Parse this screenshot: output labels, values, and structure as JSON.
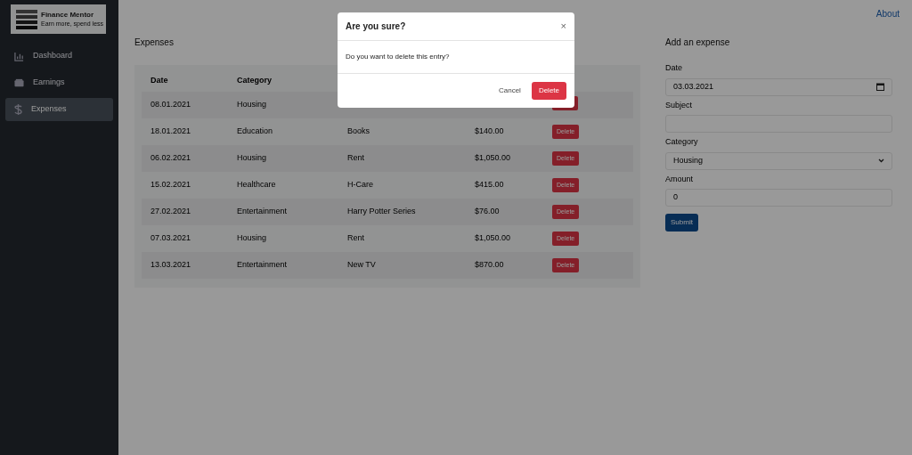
{
  "sidebar": {
    "logo": {
      "title": "Finance Mentor",
      "subtitle": "Earn more, spend less"
    },
    "items": [
      {
        "label": "Dashboard",
        "selected": false
      },
      {
        "label": "Earnings",
        "selected": false
      },
      {
        "label": "Expenses",
        "selected": true
      }
    ]
  },
  "top_link": "About",
  "expenses": {
    "title": "Expenses",
    "columns": [
      "Date",
      "Category"
    ],
    "rows": [
      {
        "date": "08.01.2021",
        "category": "Housing"
      },
      {
        "date": "18.01.2021",
        "category": "Education",
        "subject": "Books",
        "amount": "$140.00",
        "action": "Delete"
      },
      {
        "date": "06.02.2021",
        "category": "Housing",
        "subject": "Rent",
        "amount": "$1,050.00",
        "action": "Delete"
      },
      {
        "date": "15.02.2021",
        "category": "Healthcare",
        "subject": "H-Care",
        "amount": "$415.00",
        "action": "Delete"
      },
      {
        "date": "27.02.2021",
        "category": "Entertainment",
        "subject": "Harry Potter Series",
        "amount": "$76.00",
        "action": "Delete"
      },
      {
        "date": "07.03.2021",
        "category": "Housing",
        "subject": "Rent",
        "amount": "$1,050.00",
        "action": "Delete"
      },
      {
        "date": "13.03.2021",
        "category": "Entertainment",
        "subject": "New TV",
        "amount": "$870.00",
        "action": "Delete"
      }
    ]
  },
  "form": {
    "title": "Add an expense",
    "fields": [
      {
        "kind": "date",
        "label": "Date",
        "value": "03.03.2021"
      },
      {
        "kind": "text",
        "label": "Subject"
      },
      {
        "kind": "select",
        "label": "Category",
        "value": "Housing"
      },
      {
        "kind": "text",
        "label": "Amount",
        "value": "0"
      }
    ],
    "submit": "Submit"
  },
  "modal": {
    "title": "Are you sure?",
    "close": "×",
    "message": "Do you want to delete this entry?",
    "buttons": [
      {
        "kind": "secondary",
        "label": "Cancel"
      },
      {
        "kind": "danger",
        "label": "Delete"
      }
    ]
  }
}
